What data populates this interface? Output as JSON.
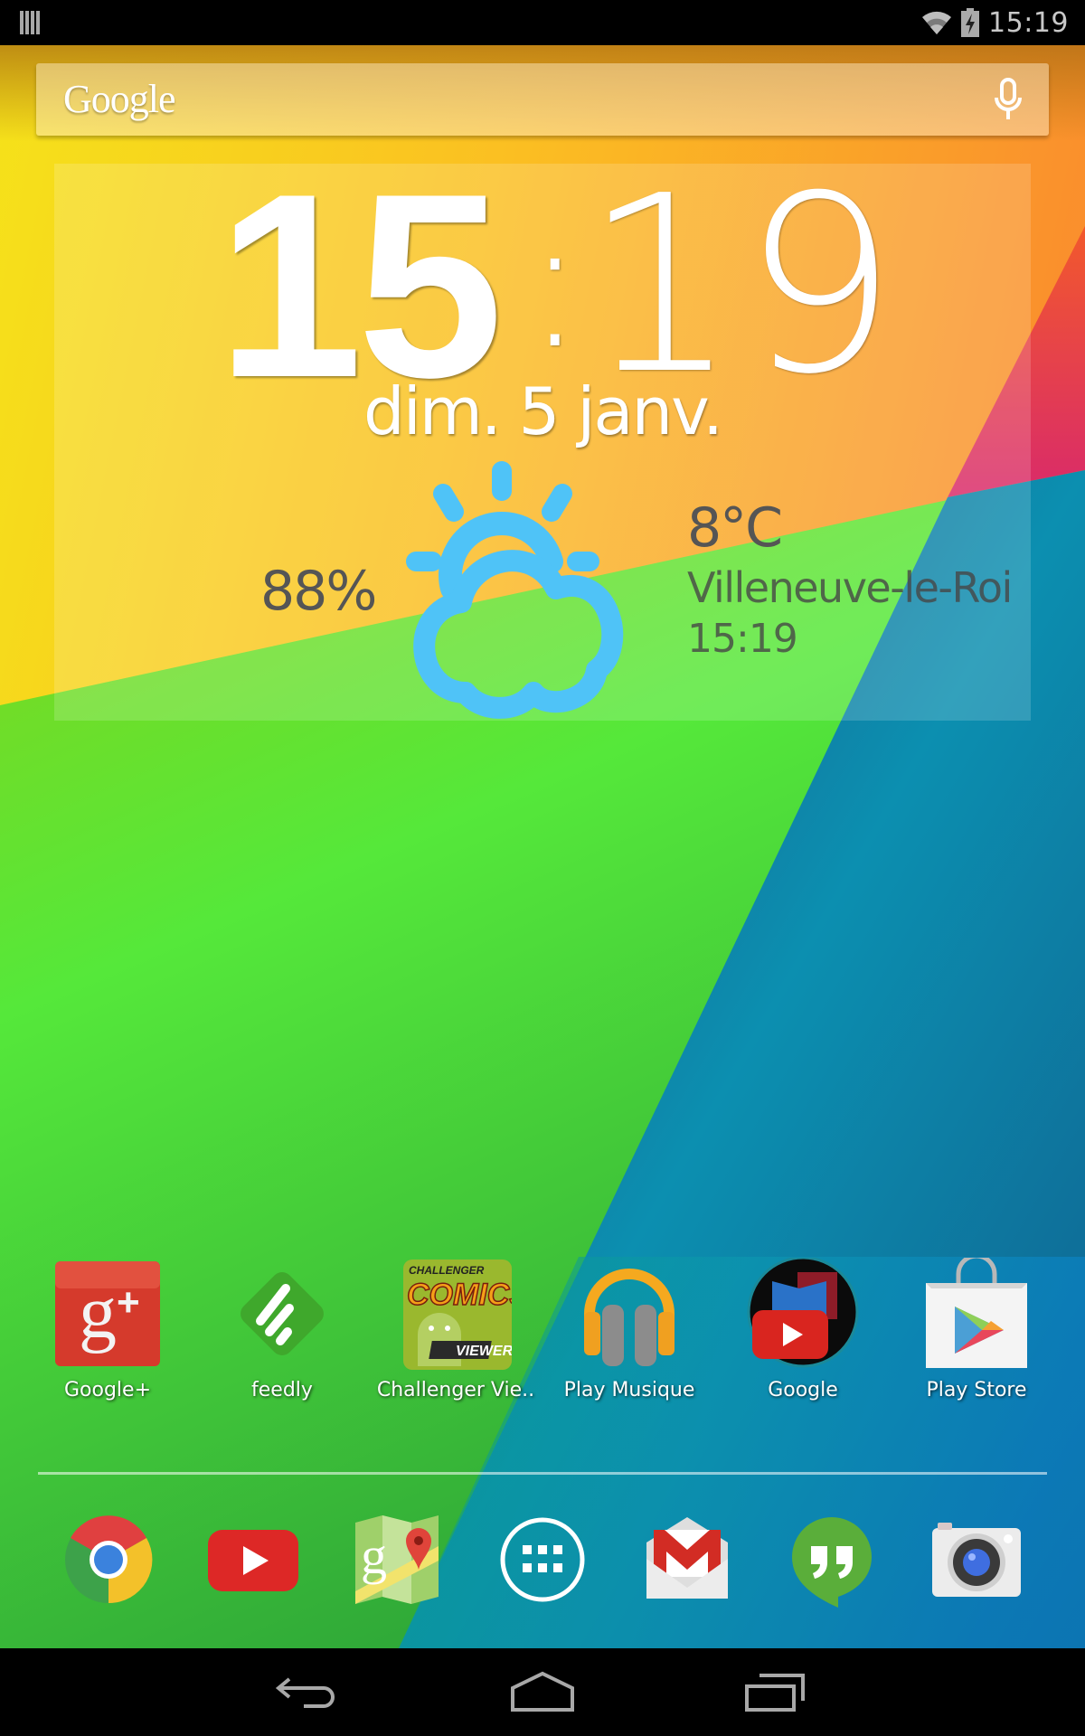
{
  "status_bar": {
    "time": "15:19",
    "icons": [
      "notification-icon",
      "wifi-icon",
      "battery-charging-icon"
    ]
  },
  "search": {
    "logo_text": "Google",
    "voice_icon": "mic-icon"
  },
  "clock_widget": {
    "hours": "15",
    "separator": ":",
    "minutes": "19",
    "date": "dim. 5 janv.",
    "humidity": "88%",
    "weather_icon": "partly-cloudy-icon",
    "temperature": "8°C",
    "location": "Villeneuve-le-Roi",
    "updated_time": "15:19"
  },
  "apps": [
    {
      "label": "Google+",
      "icon": "google-plus-icon"
    },
    {
      "label": "feedly",
      "icon": "feedly-icon"
    },
    {
      "label": "Challenger Vie..",
      "icon": "challenger-comics-icon"
    },
    {
      "label": "Play Musique",
      "icon": "play-music-icon"
    },
    {
      "label": "Google",
      "icon": "google-folder-icon"
    },
    {
      "label": "Play Store",
      "icon": "play-store-icon"
    }
  ],
  "dock": [
    {
      "icon": "chrome-icon"
    },
    {
      "icon": "youtube-icon"
    },
    {
      "icon": "maps-icon"
    },
    {
      "icon": "app-drawer-icon"
    },
    {
      "icon": "gmail-icon"
    },
    {
      "icon": "hangouts-icon"
    },
    {
      "icon": "camera-icon"
    }
  ],
  "nav_bar": {
    "buttons": [
      "back-icon",
      "home-icon",
      "recents-icon"
    ]
  },
  "colors": {
    "wallpaper_yellow": "#f7e21a",
    "wallpaper_orange": "#f7942a",
    "wallpaper_pink": "#e0306a",
    "wallpaper_green": "#4ee63a",
    "wallpaper_blue": "#0a78c8",
    "weather_icon": "#4fc3f7"
  }
}
